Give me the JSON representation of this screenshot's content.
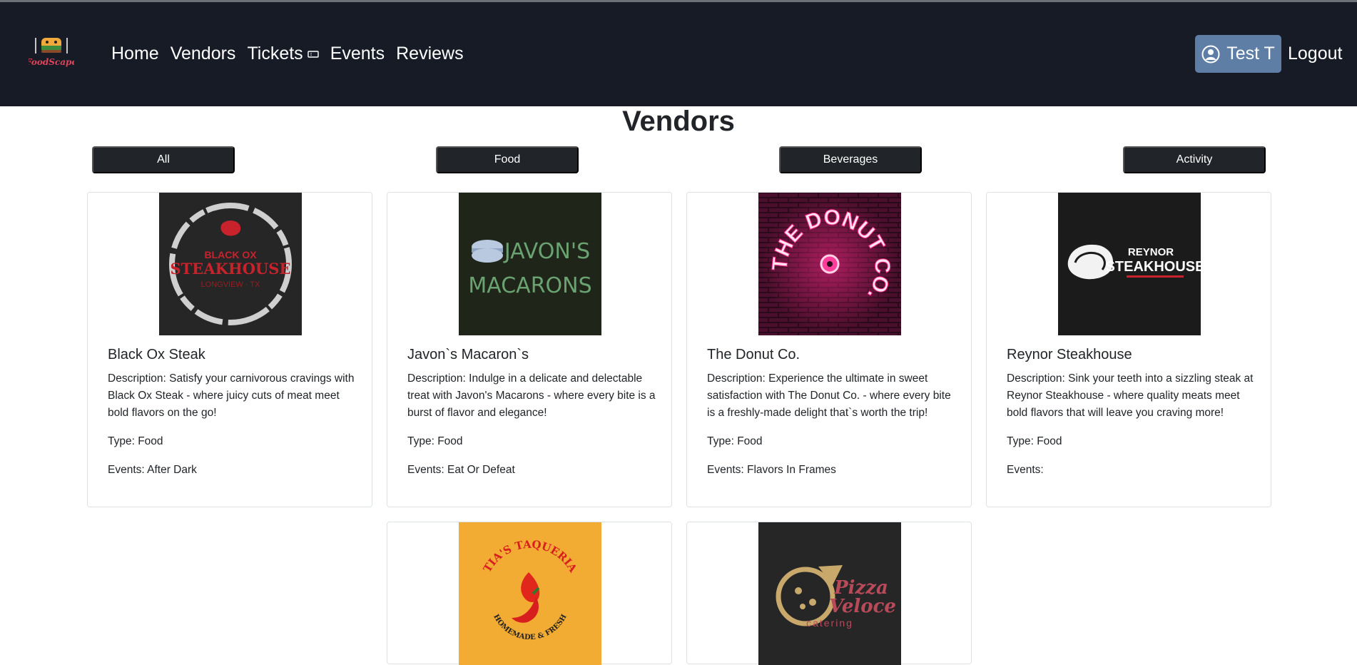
{
  "brand": {
    "logo_text": "FoodScape"
  },
  "nav": {
    "links": [
      "Home",
      "Vendors",
      "Tickets",
      "Events",
      "Reviews"
    ],
    "user_label": "Test T",
    "logout_label": "Logout"
  },
  "page": {
    "title": "Vendors"
  },
  "filters": [
    "All",
    "Food",
    "Beverages",
    "Activity"
  ],
  "vendors": [
    {
      "name": "Black Ox Steak",
      "description": "Description: Satisfy your carnivorous cravings with Black Ox Steak - where juicy cuts of meat meet bold flavors on the go!",
      "type": "Type: Food",
      "events": "Events: After Dark",
      "logo": {
        "line1": "BLACK OX",
        "line2": "STEAKHOUSE",
        "line3": "LONGVIEW · TX"
      }
    },
    {
      "name": "Javon`s Macaron`s",
      "description": "Description: Indulge in a delicate and delectable treat with Javon's Macarons - where every bite is a burst of flavor and elegance!",
      "type": "Type: Food",
      "events": "Events: Eat Or Defeat",
      "logo": {
        "line1": "JAVON'S",
        "line2": "MACARONS"
      }
    },
    {
      "name": "The Donut Co.",
      "description": "Description: Experience the ultimate in sweet satisfaction with The Donut Co. - where every bite is a freshly-made delight that`s worth the trip!",
      "type": "Type: Food",
      "events": "Events: Flavors In Frames",
      "logo": {
        "line1": "THE DONUT CO."
      }
    },
    {
      "name": "Reynor Steakhouse",
      "description": "Description: Sink your teeth into a sizzling steak at Reynor Steakhouse - where quality meats meet bold flavors that will leave you craving more!",
      "type": "Type: Food",
      "events": "Events:",
      "logo": {
        "line1": "REYNOR",
        "line2": "STEAKHOUSE"
      }
    },
    {
      "name": "Tia's Taqueria",
      "logo": {
        "line1": "TIA'S TAQUERIA",
        "line2": "HOMEMADE & FRESH"
      }
    },
    {
      "name": "Pizza Veloce",
      "logo": {
        "line1": "Pizza",
        "line2": "Veloce",
        "line3": "catering"
      }
    }
  ],
  "colors": {
    "navbar": "#161b26",
    "user_button": "#5f7ea6",
    "filter_button": "#212529"
  }
}
